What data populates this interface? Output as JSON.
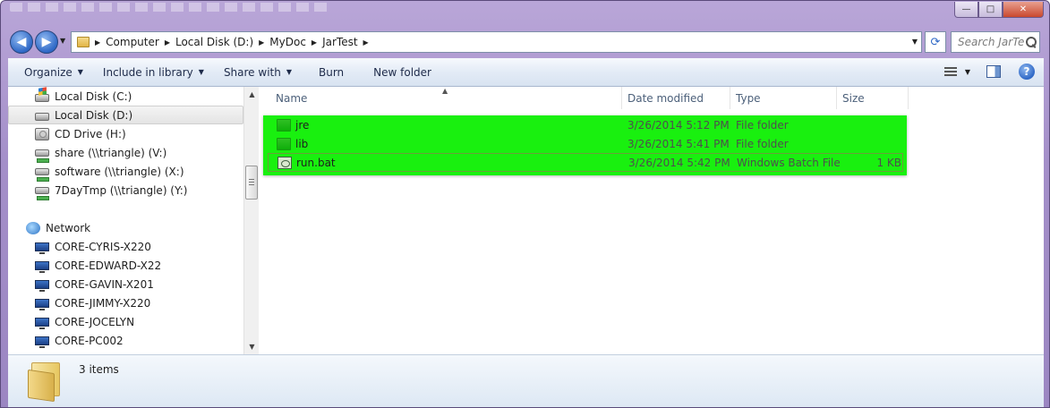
{
  "window": {
    "caption_buttons": {
      "minimize": "—",
      "maximize": "□",
      "close": "✕"
    }
  },
  "address": {
    "breadcrumbs": [
      "Computer",
      "Local Disk (D:)",
      "MyDoc",
      "JarTest"
    ],
    "search_placeholder": "Search JarTest"
  },
  "toolbar": {
    "organize": "Organize",
    "include_in_library": "Include in library",
    "share_with": "Share with",
    "burn": "Burn",
    "new_folder": "New folder"
  },
  "nav": {
    "items": [
      {
        "label": "Local Disk (C:)",
        "icon": "drive-windows-icon",
        "selected": false
      },
      {
        "label": "Local Disk (D:)",
        "icon": "drive-icon",
        "selected": true
      },
      {
        "label": "CD Drive (H:)",
        "icon": "cd-drive-icon",
        "selected": false
      },
      {
        "label": "share (\\\\triangle) (V:)",
        "icon": "network-drive-icon",
        "selected": false
      },
      {
        "label": "software (\\\\triangle) (X:)",
        "icon": "network-drive-icon",
        "selected": false
      },
      {
        "label": "7DayTmp (\\\\triangle) (Y:)",
        "icon": "network-drive-icon",
        "selected": false
      },
      {
        "label": "Network",
        "icon": "network-icon",
        "selected": false
      },
      {
        "label": "CORE-CYRIS-X220",
        "icon": "computer-icon",
        "selected": false
      },
      {
        "label": "CORE-EDWARD-X22",
        "icon": "computer-icon",
        "selected": false
      },
      {
        "label": "CORE-GAVIN-X201",
        "icon": "computer-icon",
        "selected": false
      },
      {
        "label": "CORE-JIMMY-X220",
        "icon": "computer-icon",
        "selected": false
      },
      {
        "label": "CORE-JOCELYN",
        "icon": "computer-icon",
        "selected": false
      },
      {
        "label": "CORE-PC002",
        "icon": "computer-icon",
        "selected": false
      }
    ]
  },
  "columns": {
    "name": "Name",
    "date_modified": "Date modified",
    "type": "Type",
    "size": "Size"
  },
  "files": [
    {
      "name": "jre",
      "date": "3/26/2014 5:12 PM",
      "type": "File folder",
      "size": "",
      "icon": "folder-icon"
    },
    {
      "name": "lib",
      "date": "3/26/2014 5:41 PM",
      "type": "File folder",
      "size": "",
      "icon": "folder-icon"
    },
    {
      "name": "run.bat",
      "date": "3/26/2014 5:42 PM",
      "type": "Windows Batch File",
      "size": "1 KB",
      "icon": "batch-file-icon"
    }
  ],
  "status": {
    "items_count": "3 items"
  },
  "colors": {
    "highlight": "#19f00f",
    "window_frame": "#a48fc9"
  }
}
